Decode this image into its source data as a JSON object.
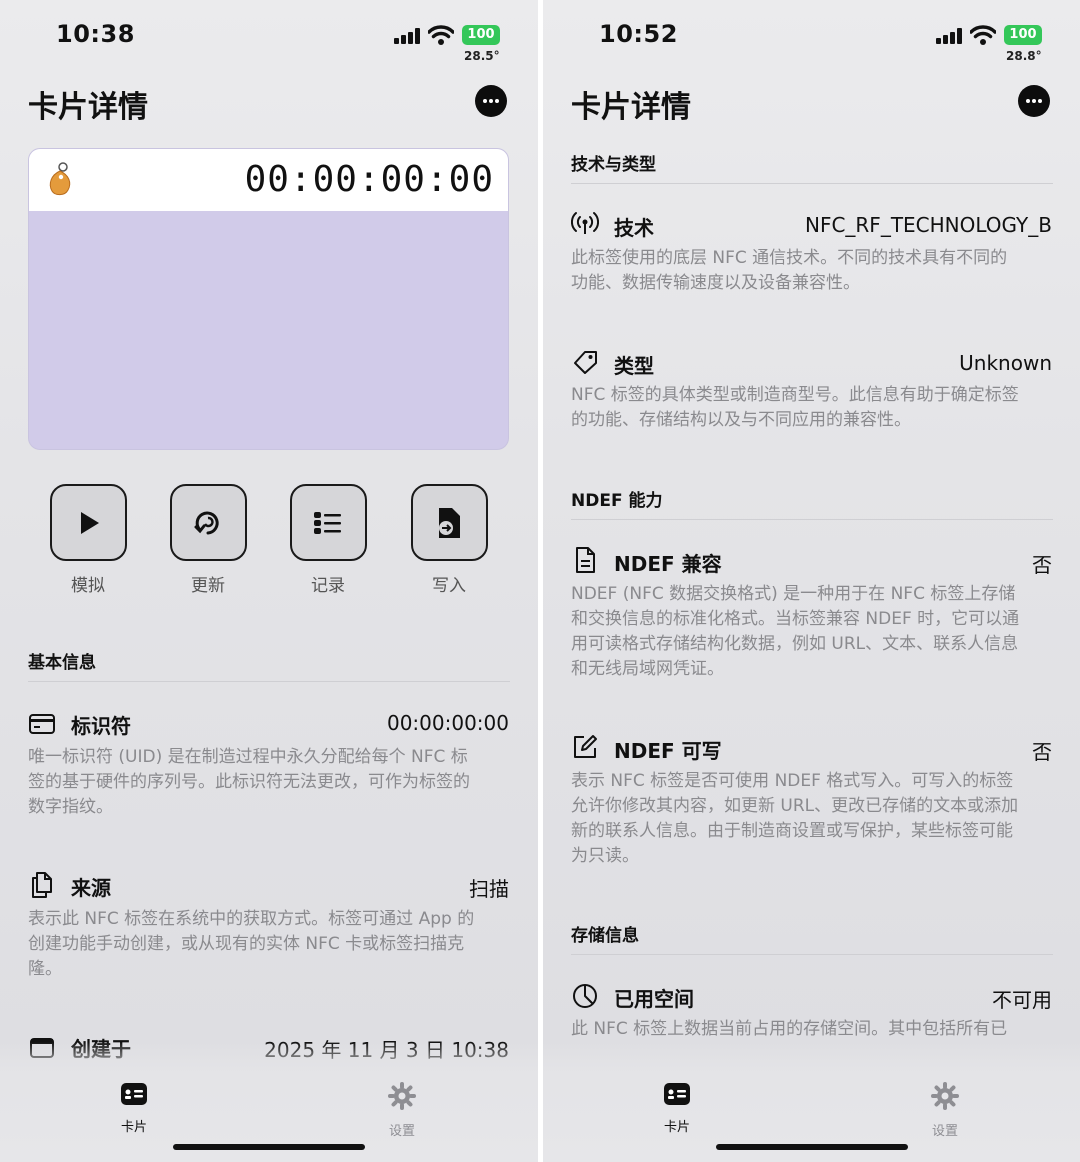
{
  "left": {
    "status": {
      "time": "10:38",
      "battery": "100",
      "temp": "28.5°"
    },
    "title": "卡片详情",
    "card": {
      "uid_display": "00:00:00:00",
      "body_color": "#d1cbe9"
    },
    "actions": [
      {
        "label": "模拟",
        "icon": "play-icon"
      },
      {
        "label": "更新",
        "icon": "refresh-icon"
      },
      {
        "label": "记录",
        "icon": "list-icon"
      },
      {
        "label": "写入",
        "icon": "write-file-icon"
      }
    ],
    "section_basic": "基本信息",
    "rows": [
      {
        "icon": "card-icon",
        "label": "标识符",
        "value": "00:00:00:00",
        "desc": [
          "唯一标识符 (UID) 是在制造过程中永久分配给每个 NFC 标",
          "签的基于硬件的序列号。此标识符无法更改，可作为标签的",
          "数字指纹。"
        ]
      },
      {
        "icon": "copy-document-icon",
        "label": "来源",
        "value": "扫描",
        "desc": [
          "表示此 NFC 标签在系统中的获取方式。标签可通过 App 的",
          "创建功能手动创建，或从现有的实体 NFC 卡或标签扫描克",
          "隆。"
        ]
      },
      {
        "icon": "calendar-icon",
        "label": "创建于",
        "value": "2025 年 11 月 3 日 10:38",
        "desc": []
      }
    ],
    "tabs": {
      "card": "卡片",
      "settings": "设置"
    }
  },
  "right": {
    "status": {
      "time": "10:52",
      "battery": "100",
      "temp": "28.8°"
    },
    "title": "卡片详情",
    "section_tech": "技术与类型",
    "tech_rows": [
      {
        "icon": "antenna-icon",
        "label": "技术",
        "value": "NFC_RF_TECHNOLOGY_B",
        "desc": [
          "此标签使用的底层 NFC 通信技术。不同的技术具有不同的",
          "功能、数据传输速度以及设备兼容性。"
        ]
      },
      {
        "icon": "tag-icon",
        "label": "类型",
        "value": "Unknown",
        "desc": [
          "NFC 标签的具体类型或制造商型号。此信息有助于确定标签",
          "的功能、存储结构以及与不同应用的兼容性。"
        ]
      }
    ],
    "section_ndef": "NDEF 能力",
    "ndef_rows": [
      {
        "icon": "document-icon",
        "label": "NDEF 兼容",
        "value": "否",
        "desc": [
          "NDEF (NFC 数据交换格式) 是一种用于在 NFC 标签上存储",
          "和交换信息的标准化格式。当标签兼容 NDEF 时，它可以通",
          "用可读格式存储结构化数据，例如 URL、文本、联系人信息",
          "和无线局域网凭证。"
        ]
      },
      {
        "icon": "edit-icon",
        "label": "NDEF 可写",
        "value": "否",
        "desc": [
          "表示 NFC 标签是否可使用 NDEF 格式写入。可写入的标签",
          "允许你修改其内容，如更新 URL、更改已存储的文本或添加",
          "新的联系人信息。由于制造商设置或写保护，某些标签可能",
          "为只读。"
        ]
      }
    ],
    "section_storage": "存储信息",
    "storage_rows": [
      {
        "icon": "pie-chart-icon",
        "label": "已用空间",
        "value": "不可用",
        "desc": [
          "此 NFC 标签上数据当前占用的存储空间。其中包括所有已"
        ]
      }
    ],
    "tabs": {
      "card": "卡片",
      "settings": "设置"
    }
  }
}
